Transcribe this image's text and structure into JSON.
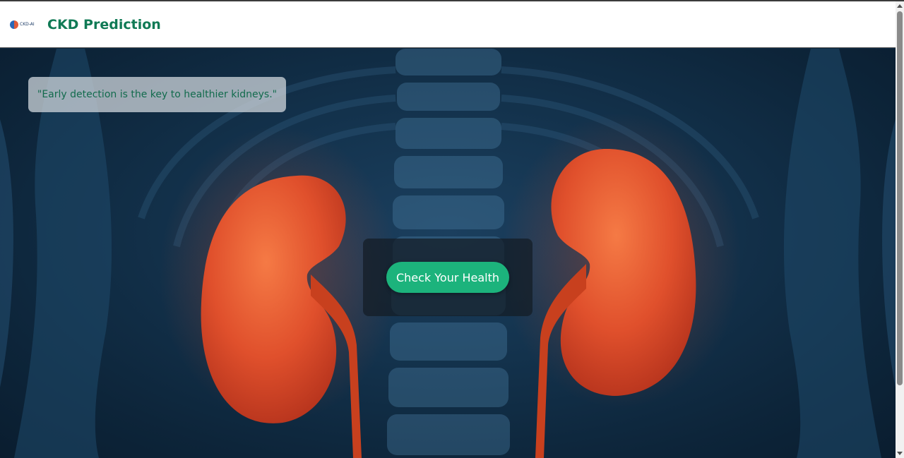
{
  "header": {
    "logo_text": "CKD-AI",
    "brand": "CKD Prediction"
  },
  "hero": {
    "quote": "\"Early detection is the key to healthier kidneys.\"",
    "cta_label": "Check Your Health"
  },
  "colors": {
    "brand_green": "#107a55",
    "cta_green": "#1cb37c",
    "kidney": "#e0502c",
    "background": "#14344f"
  },
  "icons": {
    "logo": "ckd-ai-logo-icon",
    "hero_image": "kidneys-illustration"
  }
}
